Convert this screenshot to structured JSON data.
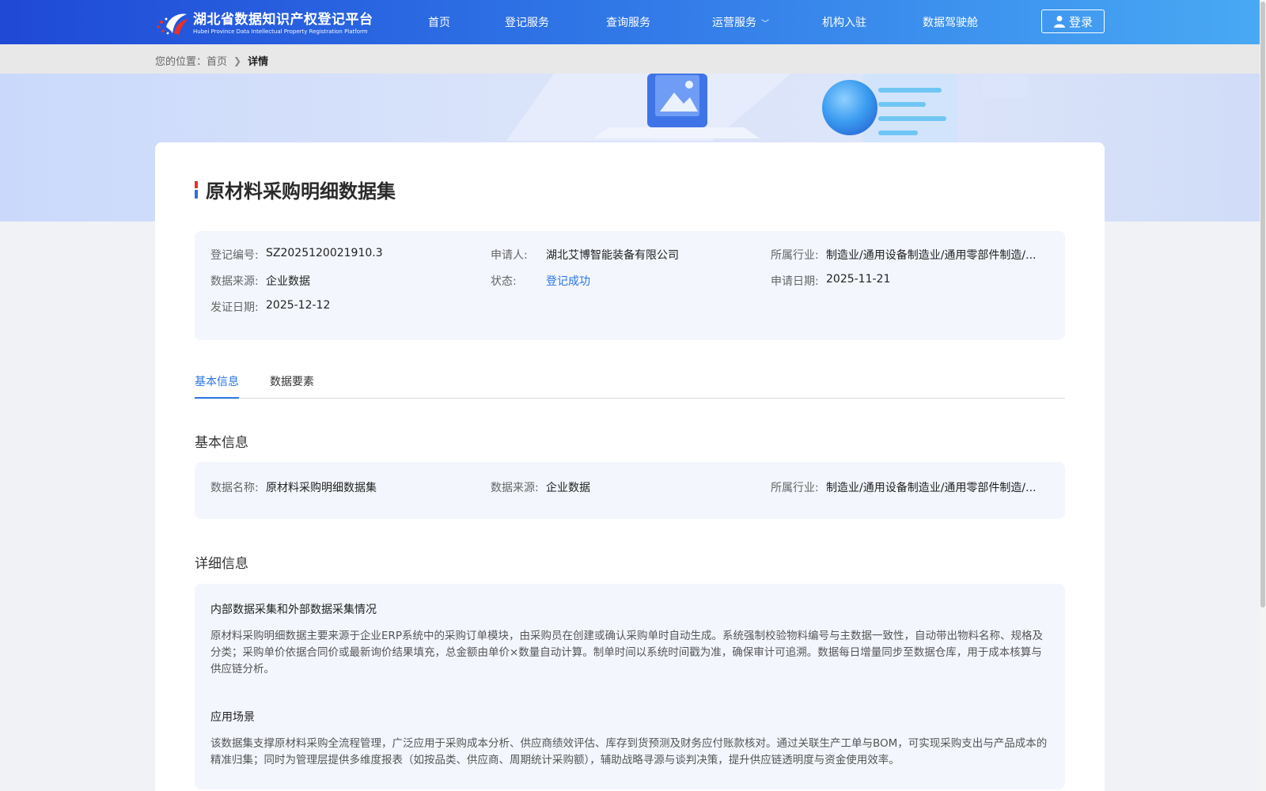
{
  "header": {
    "logo_cn": "湖北省数据知识产权登记平台",
    "logo_en": "Hubei Province Data Intellectual Property Registration Platform",
    "nav": [
      {
        "label": "首页"
      },
      {
        "label": "登记服务"
      },
      {
        "label": "查询服务"
      },
      {
        "label": "运营服务",
        "has_dropdown": true
      },
      {
        "label": "机构入驻"
      },
      {
        "label": "数据驾驶舱"
      }
    ],
    "login_label": "登录"
  },
  "breadcrumb": {
    "prefix": "您的位置：",
    "home": "首页",
    "current": "详情"
  },
  "detail": {
    "title": "原材料采购明细数据集",
    "summary": [
      {
        "key": "登记编号:",
        "value": "SZ2025120021910.3"
      },
      {
        "key": "申请人:",
        "value": "湖北艾博智能装备有限公司"
      },
      {
        "key": "所属行业:",
        "value": "制造业/通用设备制造业/通用零部件制造/..."
      },
      {
        "key": "数据来源:",
        "value": "企业数据"
      },
      {
        "key": "状态:",
        "value": "登记成功"
      },
      {
        "key": "申请日期:",
        "value": "2025-11-21"
      },
      {
        "key": "发证日期:",
        "value": "2025-12-12"
      }
    ],
    "tabs": [
      {
        "label": "基本信息",
        "active": true
      },
      {
        "label": "数据要素",
        "active": false
      }
    ],
    "basic_title": "基本信息",
    "basic": [
      {
        "key": "数据名称:",
        "value": "原材料采购明细数据集"
      },
      {
        "key": "数据来源:",
        "value": "企业数据"
      },
      {
        "key": "所属行业:",
        "value": "制造业/通用设备制造业/通用零部件制造/..."
      }
    ],
    "detail_title": "详细信息",
    "sections": [
      {
        "heading": "内部数据采集和外部数据采集情况",
        "text": "原材料采购明细数据主要来源于企业ERP系统中的采购订单模块，由采购员在创建或确认采购单时自动生成。系统强制校验物料编号与主数据一致性，自动带出物料名称、规格及分类；采购单价依据合同价或最新询价结果填充，总金额由单价×数量自动计算。制单时间以系统时间戳为准，确保审计可追溯。数据每日增量同步至数据仓库，用于成本核算与供应链分析。"
      },
      {
        "heading": "应用场景",
        "text": "该数据集支撑原材料采购全流程管理，广泛应用于采购成本分析、供应商绩效评估、库存到货预测及财务应付账款核对。通过关联生产工单与BOM，可实现采购支出与产品成本的精准归集；同时为管理层提供多维度报表（如按品类、供应商、周期统计采购额），辅助战略寻源与谈判决策，提升供应链透明度与资金使用效率。"
      }
    ]
  },
  "colors": {
    "header_start": "#1f49d6",
    "header_end": "#48a9f4",
    "accent": "#2a75e0",
    "panel_bg": "#f3f6fd"
  }
}
